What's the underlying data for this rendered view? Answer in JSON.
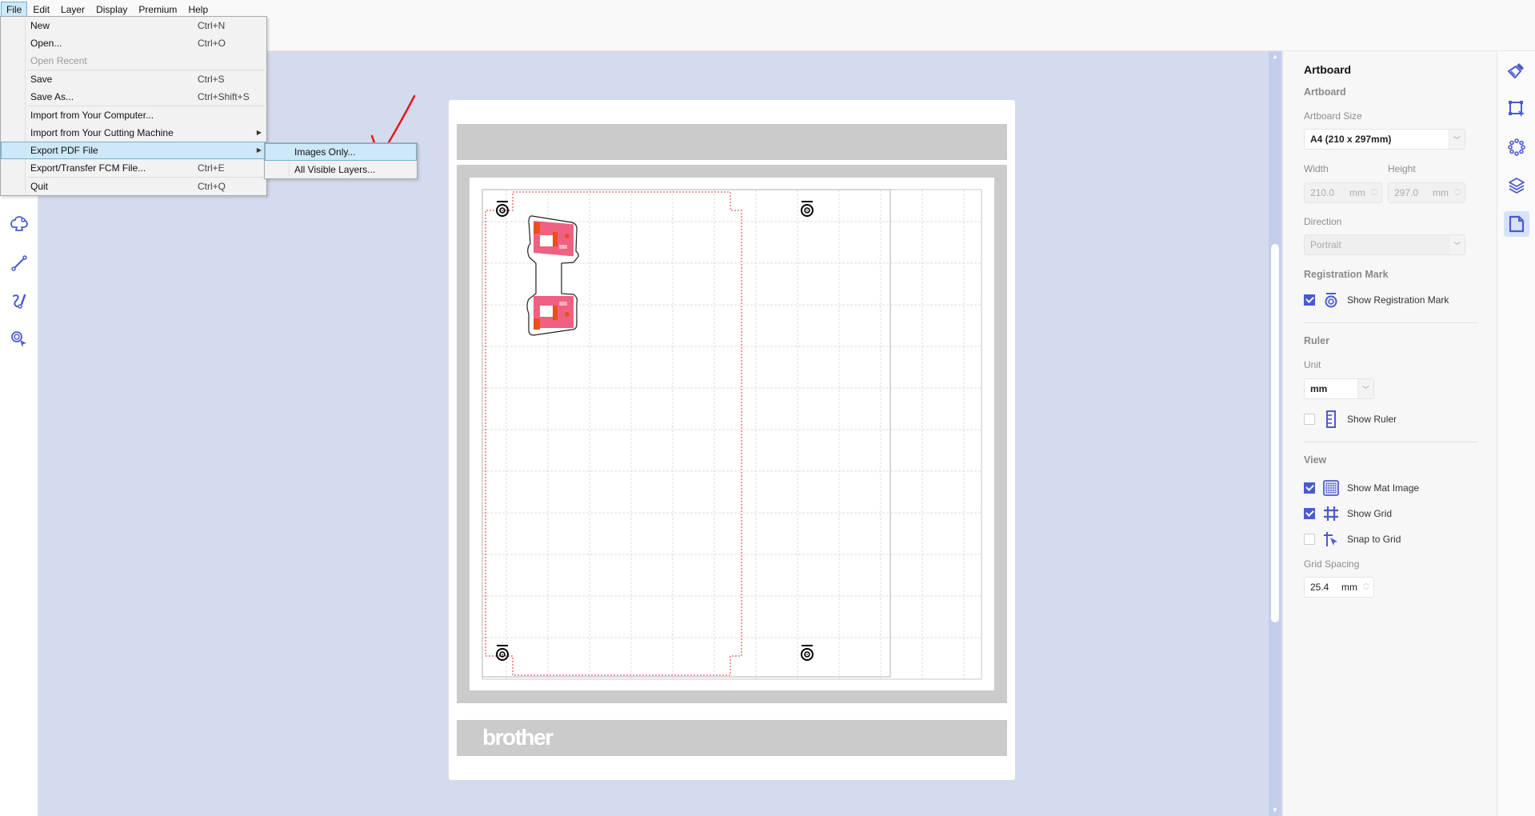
{
  "menubar": {
    "items": [
      {
        "label": "File",
        "active": true
      },
      {
        "label": "Edit"
      },
      {
        "label": "Layer"
      },
      {
        "label": "Display"
      },
      {
        "label": "Premium"
      },
      {
        "label": "Help"
      }
    ]
  },
  "file_menu": {
    "new": {
      "label": "New",
      "shortcut": "Ctrl+N"
    },
    "open": {
      "label": "Open...",
      "shortcut": "Ctrl+O"
    },
    "open_recent": {
      "label": "Open Recent"
    },
    "save": {
      "label": "Save",
      "shortcut": "Ctrl+S"
    },
    "save_as": {
      "label": "Save As...",
      "shortcut": "Ctrl+Shift+S"
    },
    "import_computer": {
      "label": "Import from Your Computer..."
    },
    "import_machine": {
      "label": "Import from Your Cutting Machine"
    },
    "export_pdf": {
      "label": "Export PDF File"
    },
    "export_fcm": {
      "label": "Export/Transfer FCM File...",
      "shortcut": "Ctrl+E"
    },
    "quit": {
      "label": "Quit",
      "shortcut": "Ctrl+Q"
    }
  },
  "export_pdf_submenu": {
    "images_only": "Images Only...",
    "all_visible_layers": "All Visible Layers..."
  },
  "left_toolbar": {
    "icons": [
      "shape-icon",
      "line-icon",
      "freehand-icon",
      "registration-mark-select-icon"
    ]
  },
  "canvas": {
    "brand_text": "brother",
    "annotation_arrow_color": "#e8141e"
  },
  "right_panel": {
    "title": "Artboard",
    "section_artboard": "Artboard",
    "artboard_size_label": "Artboard Size",
    "artboard_size_value": "A4 (210 x 297mm)",
    "width_label": "Width",
    "width_value": "210.0",
    "width_unit": "mm",
    "height_label": "Height",
    "height_value": "297.0",
    "height_unit": "mm",
    "direction_label": "Direction",
    "direction_value": "Portrait",
    "registration_label": "Registration Mark",
    "show_registration": {
      "label": "Show Registration Mark",
      "checked": true
    },
    "section_ruler": "Ruler",
    "unit_label": "Unit",
    "unit_value": "mm",
    "show_ruler": {
      "label": "Show Ruler",
      "checked": false
    },
    "section_view": "View",
    "show_mat_image": {
      "label": "Show Mat Image",
      "checked": true
    },
    "show_grid": {
      "label": "Show Grid",
      "checked": true
    },
    "snap_to_grid": {
      "label": "Snap to Grid",
      "checked": false
    },
    "grid_spacing_label": "Grid Spacing",
    "grid_spacing_value": "25.4",
    "grid_spacing_unit": "mm"
  },
  "right_icon_column": {
    "icons": [
      "brush-icon",
      "transform-icon",
      "arrange-circle-icon",
      "layers-icon",
      "artboard-page-icon"
    ],
    "active": "artboard-page-icon"
  },
  "colors": {
    "accent": "#4a5bd0",
    "canvas_bg": "#d5dbee",
    "menu_highlight": "#cde8f7",
    "mat_gray": "#cbcbcb"
  }
}
